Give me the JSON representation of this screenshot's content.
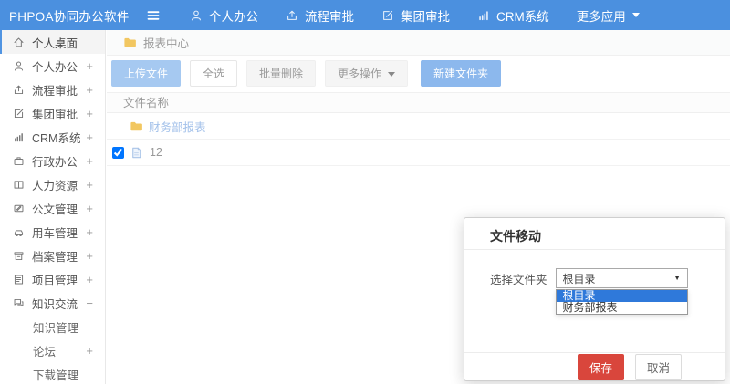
{
  "topbar": {
    "brand": "PHPOA协同办公软件",
    "nav": [
      {
        "label": "个人办公",
        "icon": "user-icon"
      },
      {
        "label": "流程审批",
        "icon": "process-icon"
      },
      {
        "label": "集团审批",
        "icon": "edit-icon"
      },
      {
        "label": "CRM系统",
        "icon": "bar-chart-icon"
      },
      {
        "label": "更多应用",
        "icon": "caret-down-icon"
      }
    ]
  },
  "sidebar": {
    "items": [
      {
        "label": "个人桌面",
        "icon": "home-icon",
        "active": true
      },
      {
        "label": "个人办公",
        "icon": "user-icon",
        "expand": "+"
      },
      {
        "label": "流程审批",
        "icon": "process-icon",
        "expand": "+"
      },
      {
        "label": "集团审批",
        "icon": "edit-icon",
        "expand": "+"
      },
      {
        "label": "CRM系统",
        "icon": "bar-chart-icon",
        "expand": "+"
      },
      {
        "label": "行政办公",
        "icon": "briefcase-icon",
        "expand": "+"
      },
      {
        "label": "人力资源",
        "icon": "book-icon",
        "expand": "+"
      },
      {
        "label": "公文管理",
        "icon": "document-pen-icon",
        "expand": "+"
      },
      {
        "label": "用车管理",
        "icon": "car-icon",
        "expand": "+"
      },
      {
        "label": "档案管理",
        "icon": "archive-icon",
        "expand": "+"
      },
      {
        "label": "项目管理",
        "icon": "clipboard-icon",
        "expand": "+"
      },
      {
        "label": "知识交流",
        "icon": "chat-icon",
        "expand": "−",
        "children": [
          {
            "label": "知识管理"
          },
          {
            "label": "论坛",
            "expand": "+"
          },
          {
            "label": "下载管理"
          }
        ]
      }
    ]
  },
  "breadcrumb": {
    "label": "报表中心",
    "icon": "folder-icon"
  },
  "toolbar": {
    "buttons": [
      {
        "label": "上传文件"
      },
      {
        "label": "全选"
      },
      {
        "label": "批量删除"
      },
      {
        "label": "更多操作",
        "caret": true
      },
      {
        "label": "新建文件夹"
      }
    ]
  },
  "table": {
    "header": "文件名称",
    "rows": [
      {
        "name": "财务部报表",
        "type": "folder",
        "icon": "folder-icon"
      },
      {
        "name": "12",
        "type": "file",
        "icon": "file-icon",
        "checked_attr": "checked"
      }
    ]
  },
  "modal": {
    "title": "文件移动",
    "field_label": "选择文件夹",
    "select_value": "根目录",
    "options": [
      "根目录",
      "财务部报表"
    ],
    "selected_option_index": 0,
    "save_label": "保存",
    "cancel_label": "取消"
  },
  "colors": {
    "topbar_blue": "#4b90df",
    "upload_button_blue": "#a6c9f1",
    "new_folder_button_blue": "#8cb8ed",
    "save_button_red": "#d9463c",
    "option_highlight_blue": "#2f79da",
    "folder_yellow": "#f2c761",
    "folder_link_blue": "#a3c1ea",
    "sidebar_active_accent": "#5094e2"
  }
}
